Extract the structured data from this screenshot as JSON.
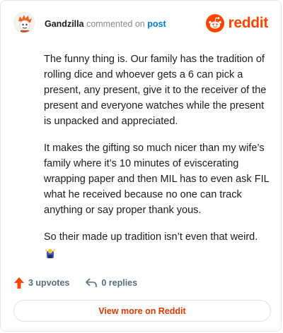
{
  "header": {
    "username": "Gandzilla",
    "action_text": "commented on",
    "post_link": "post",
    "brand": "reddit"
  },
  "comment": {
    "paragraphs": [
      "The funny thing is. Our family has the tradition of rolling dice and whoever gets a 6 can pick a present, any present, give it to the receiver of the present and everyone watches while the present is unpacked and appreciated.",
      "It makes the gifting so much nicer than my wife’s family where it’s 10 minutes of eviscerating wrapping paper and then MIL has to even ask FIL what he received because no one can track anything or say proper thank yous.",
      "So their made up tradition isn’t even that weird."
    ]
  },
  "actions": {
    "upvotes_label": "3 upvotes",
    "replies_label": "0 replies"
  },
  "footer": {
    "view_more_label": "View more on Reddit"
  },
  "colors": {
    "brand": "#ff4500",
    "link": "#0079d3",
    "view_more": "#d93a00"
  }
}
